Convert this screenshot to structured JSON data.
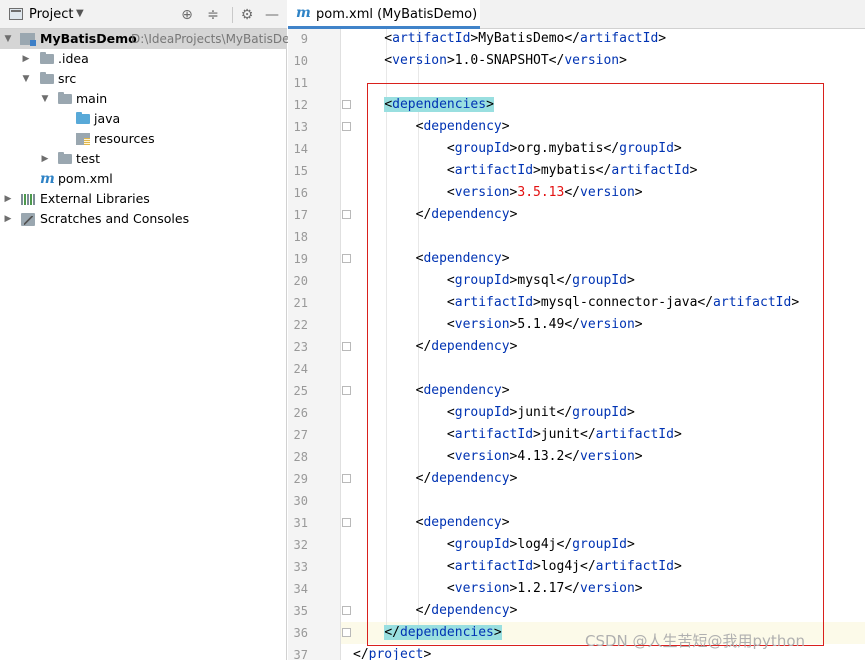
{
  "project_panel": {
    "title": "Project",
    "tree": [
      {
        "label": "MyBatisDemo",
        "path": "D:\\IdeaProjects\\MyBatisDe"
      },
      {
        "label": ".idea"
      },
      {
        "label": "src"
      },
      {
        "label": "main"
      },
      {
        "label": "java"
      },
      {
        "label": "resources"
      },
      {
        "label": "test"
      },
      {
        "label": "pom.xml"
      },
      {
        "label": "External Libraries"
      },
      {
        "label": "Scratches and Consoles"
      }
    ]
  },
  "editor": {
    "tab_label": "pom.xml (MyBatisDemo)",
    "lines": [
      {
        "no": "9",
        "text": "    <artifactId>MyBatisDemo</artifactId>"
      },
      {
        "no": "10",
        "text": "    <version>1.0-SNAPSHOT</version>"
      },
      {
        "no": "11",
        "text": ""
      },
      {
        "no": "12",
        "text": "    <dependencies>"
      },
      {
        "no": "13",
        "text": "        <dependency>"
      },
      {
        "no": "14",
        "text": "            <groupId>org.mybatis</groupId>"
      },
      {
        "no": "15",
        "text": "            <artifactId>mybatis</artifactId>"
      },
      {
        "no": "16",
        "text": "            <version>3.5.13</version>"
      },
      {
        "no": "17",
        "text": "        </dependency>"
      },
      {
        "no": "18",
        "text": ""
      },
      {
        "no": "19",
        "text": "        <dependency>"
      },
      {
        "no": "20",
        "text": "            <groupId>mysql</groupId>"
      },
      {
        "no": "21",
        "text": "            <artifactId>mysql-connector-java</artifactId>"
      },
      {
        "no": "22",
        "text": "            <version>5.1.49</version>"
      },
      {
        "no": "23",
        "text": "        </dependency>"
      },
      {
        "no": "24",
        "text": ""
      },
      {
        "no": "25",
        "text": "        <dependency>"
      },
      {
        "no": "26",
        "text": "            <groupId>junit</groupId>"
      },
      {
        "no": "27",
        "text": "            <artifactId>junit</artifactId>"
      },
      {
        "no": "28",
        "text": "            <version>4.13.2</version>"
      },
      {
        "no": "29",
        "text": "        </dependency>"
      },
      {
        "no": "30",
        "text": ""
      },
      {
        "no": "31",
        "text": "        <dependency>"
      },
      {
        "no": "32",
        "text": "            <groupId>log4j</groupId>"
      },
      {
        "no": "33",
        "text": "            <artifactId>log4j</artifactId>"
      },
      {
        "no": "34",
        "text": "            <version>1.2.17</version>"
      },
      {
        "no": "35",
        "text": "        </dependency>"
      },
      {
        "no": "36",
        "text": "    </dependencies>"
      },
      {
        "no": "37",
        "text": "</project>"
      }
    ]
  },
  "watermark": "CSDN @人生苦短@我用python",
  "colors": {
    "tag": "#0033b3",
    "highlight_border": "#d9201c",
    "tag_match_highlight": "#99dfe0",
    "red_value": "#e31212"
  }
}
